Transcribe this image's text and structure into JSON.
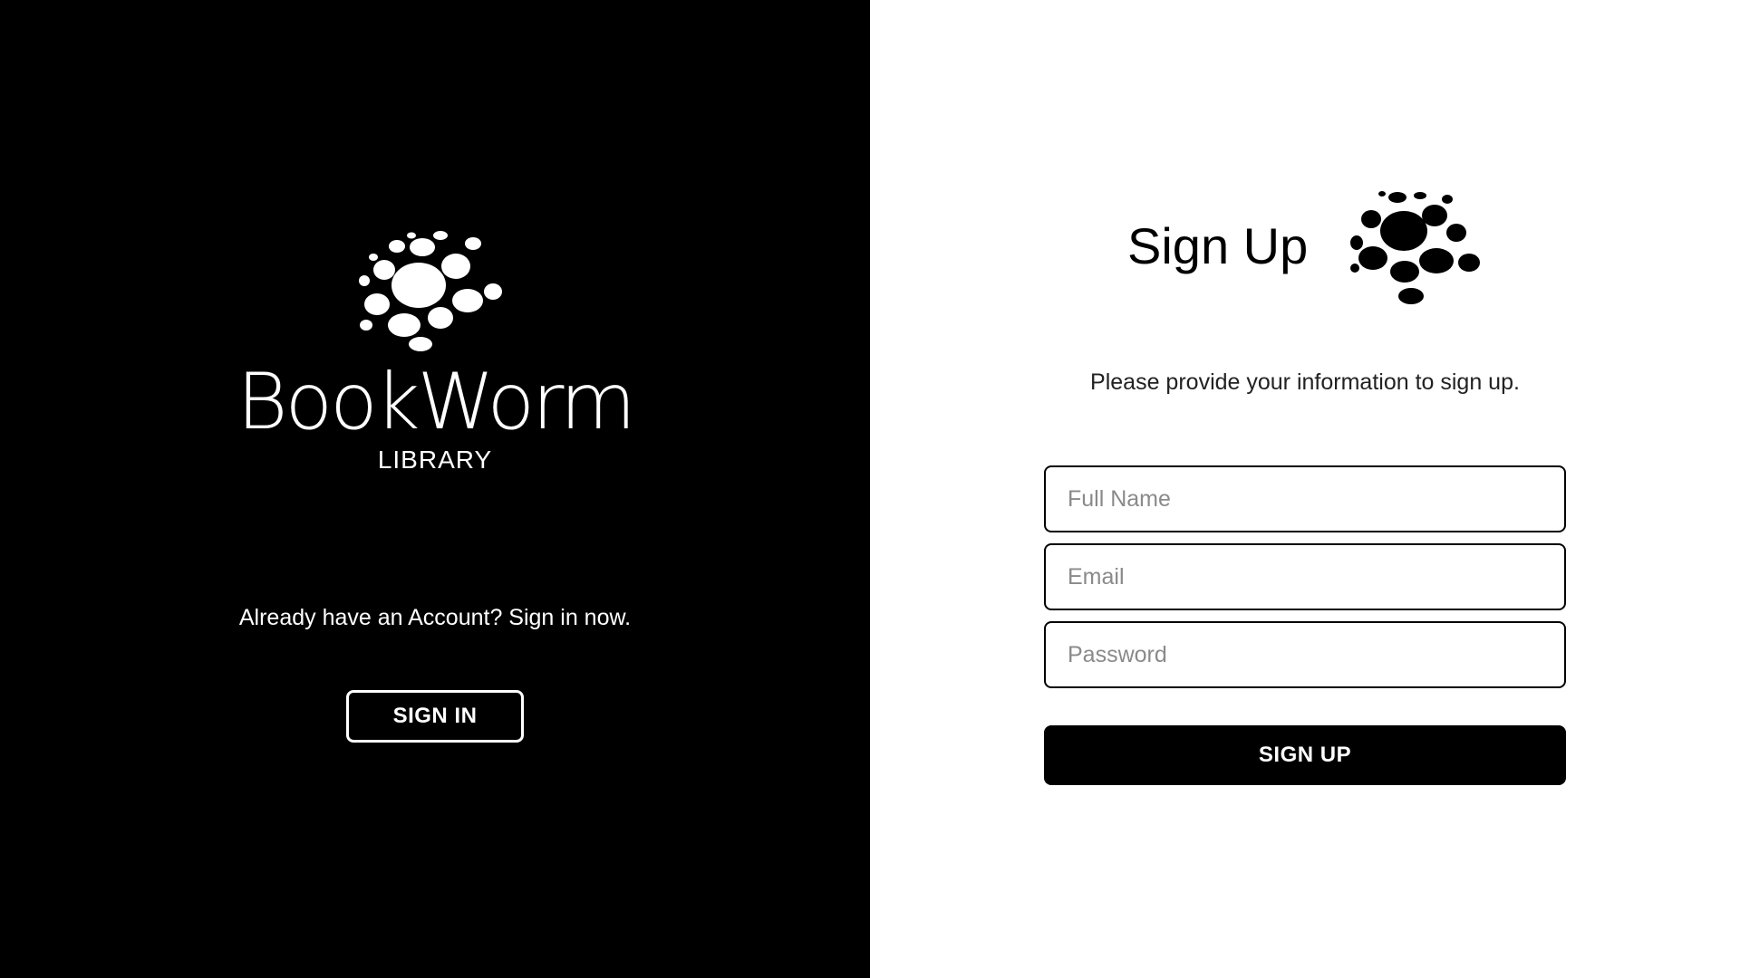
{
  "brand": {
    "logo_icon": "dots-cluster-logo",
    "name": "BookWorm",
    "subtitle": "LIBRARY"
  },
  "left_panel": {
    "prompt": "Already have an Account? Sign in now.",
    "sign_in_label": "SIGN IN"
  },
  "form": {
    "title": "Sign Up",
    "title_icon": "dots-cluster-icon",
    "description": "Please provide your information to sign up.",
    "fields": {
      "full_name": {
        "placeholder": "Full Name",
        "value": ""
      },
      "email": {
        "placeholder": "Email",
        "value": ""
      },
      "password": {
        "placeholder": "Password",
        "value": ""
      }
    },
    "submit_label": "SIGN UP"
  },
  "colors": {
    "left_panel_bg": "#000000",
    "right_panel_bg": "#ffffff",
    "accent": "#000000"
  }
}
